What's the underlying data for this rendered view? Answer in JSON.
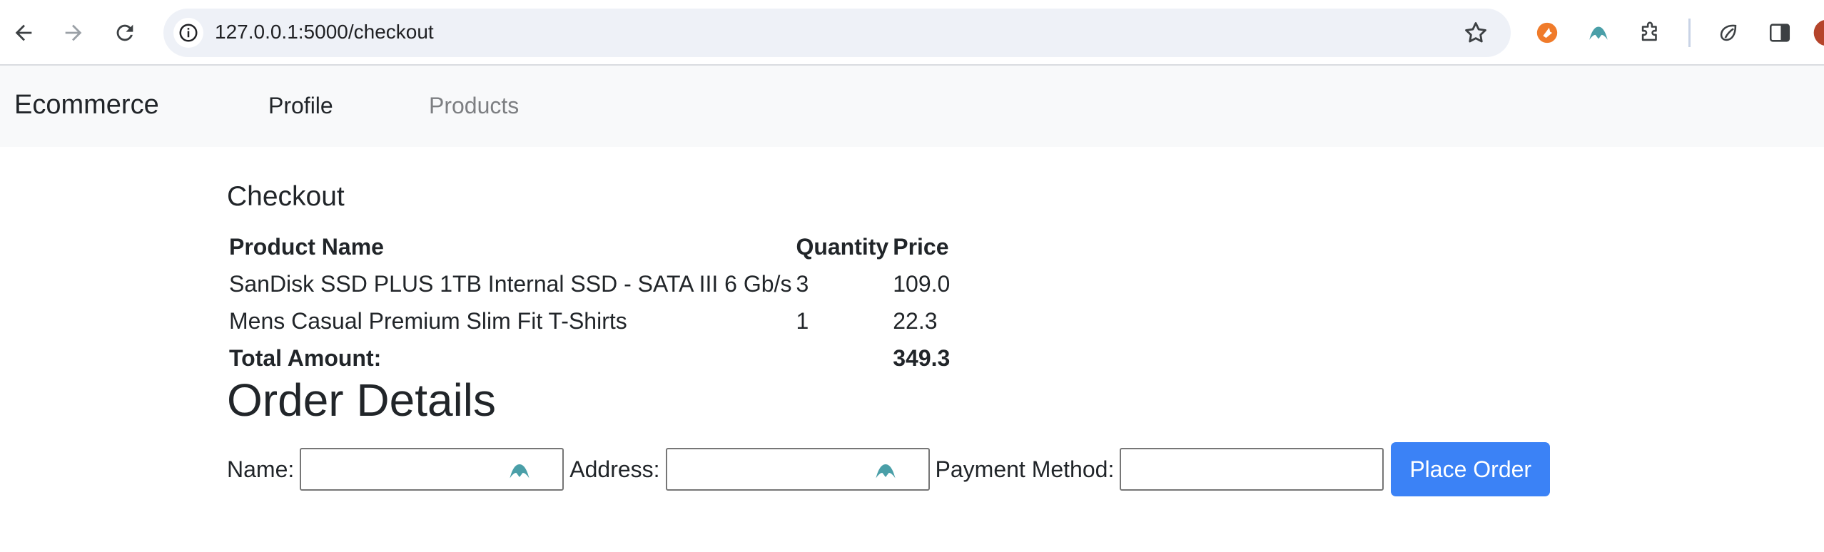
{
  "browser": {
    "url": "127.0.0.1:5000/checkout"
  },
  "navbar": {
    "brand": "Ecommerce",
    "links": [
      {
        "label": "Profile"
      },
      {
        "label": "Products"
      }
    ]
  },
  "checkout": {
    "title": "Checkout",
    "columns": [
      "Product Name",
      "Quantity",
      "Price"
    ],
    "rows": [
      {
        "name": "SanDisk SSD PLUS 1TB Internal SSD - SATA III 6 Gb/s",
        "quantity": "3",
        "price": "109.0"
      },
      {
        "name": "Mens Casual Premium Slim Fit T-Shirts",
        "quantity": "1",
        "price": "22.3"
      }
    ],
    "total_label": "Total Amount:",
    "total_value": "349.3"
  },
  "order": {
    "title": "Order Details",
    "name_label": "Name:",
    "name_value": "",
    "address_label": "Address:",
    "address_value": "",
    "payment_label": "Payment Method:",
    "payment_value": "",
    "submit_label": "Place Order"
  },
  "colors": {
    "accent": "#3b82f6",
    "navbar_bg": "#f8f9fa",
    "field_icon": "#4a9fa8"
  }
}
